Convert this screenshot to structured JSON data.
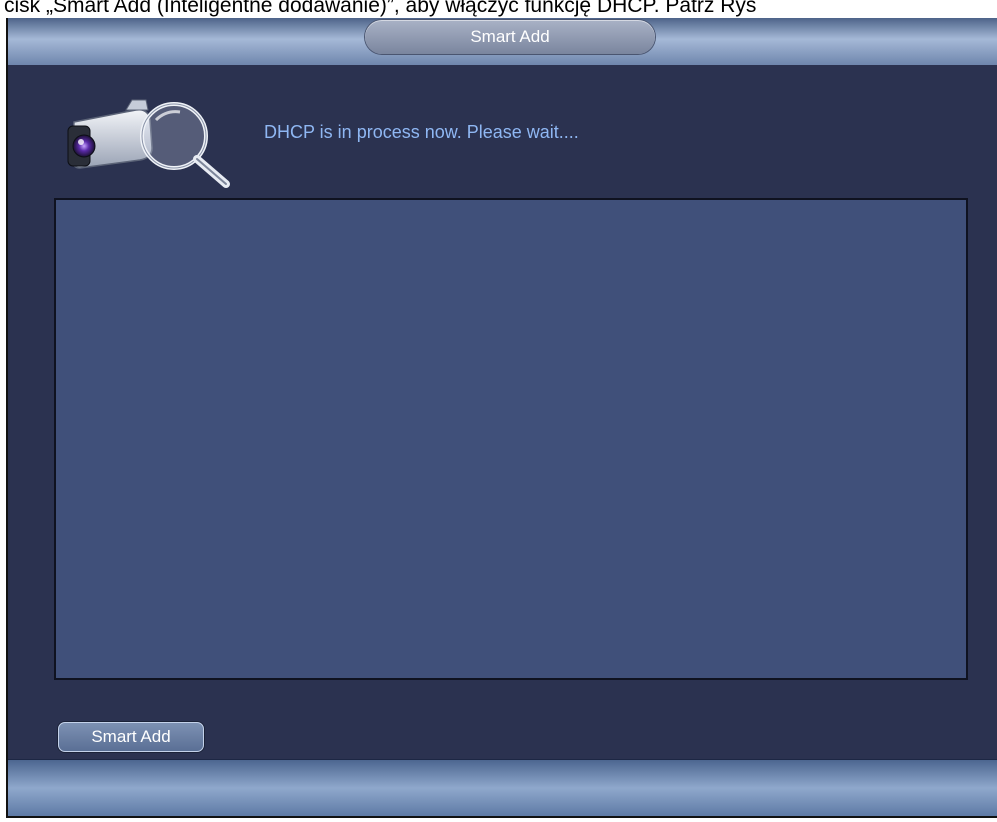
{
  "document": {
    "caption": "cisk „Smart Add (Inteligentne dodawanie)”, aby włączyć funkcję DHCP. Patrz Rys"
  },
  "window": {
    "title": "Smart Add"
  },
  "status": {
    "message": "DHCP is in process now. Please wait...."
  },
  "icons": {
    "header_icon": "camera-search-icon"
  },
  "buttons": {
    "smart_add_label": "Smart Add"
  },
  "colors": {
    "panel_background": "#2b3250",
    "list_background": "#40507a",
    "status_text": "#8fb7f3"
  }
}
